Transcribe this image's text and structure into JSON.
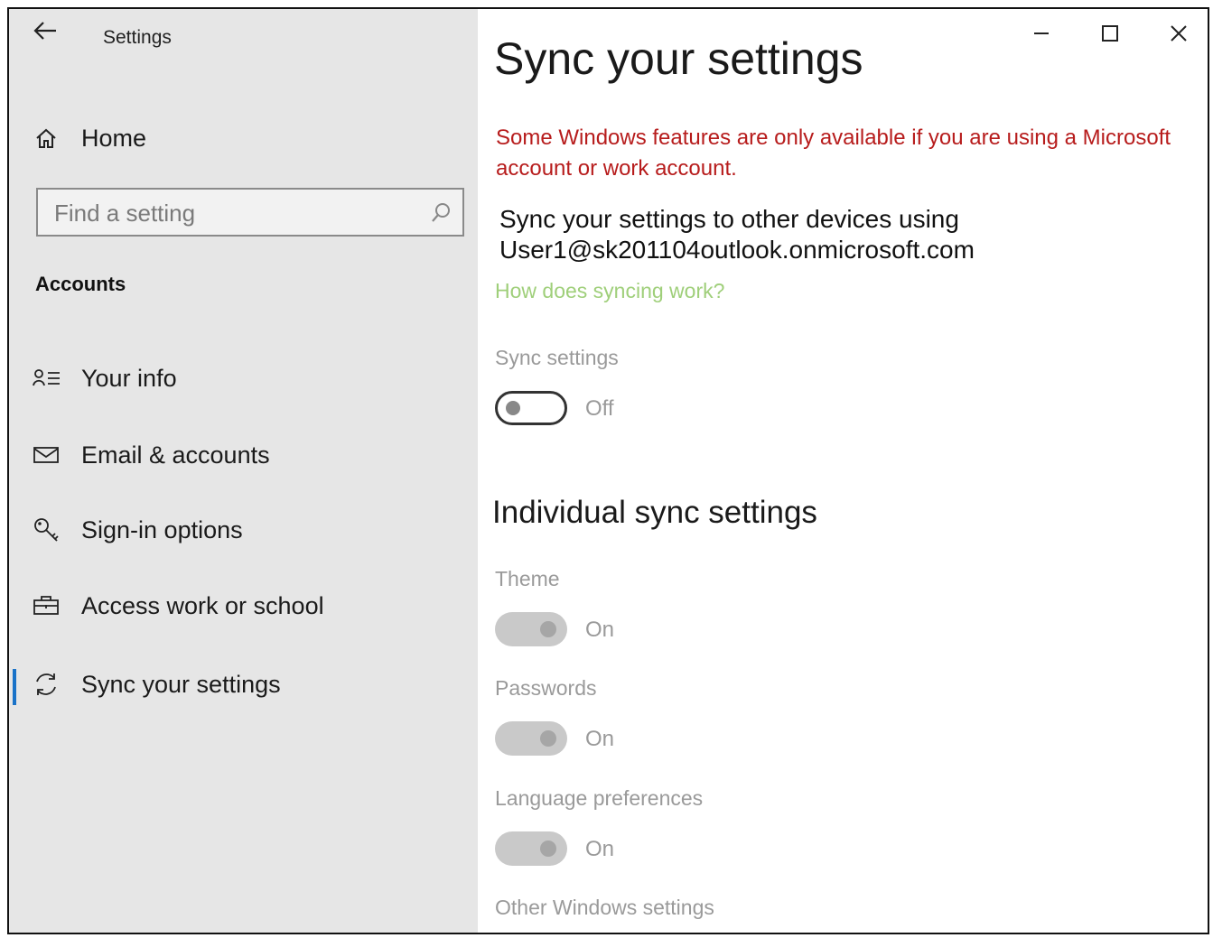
{
  "app": {
    "title": "Settings"
  },
  "sidebar": {
    "home_label": "Home",
    "search": {
      "placeholder": "Find a setting"
    },
    "section_title": "Accounts",
    "items": [
      {
        "label": "Your info",
        "icon": "person-list-icon"
      },
      {
        "label": "Email & accounts",
        "icon": "envelope-icon"
      },
      {
        "label": "Sign-in options",
        "icon": "key-icon"
      },
      {
        "label": "Access work or school",
        "icon": "briefcase-icon"
      },
      {
        "label": "Sync your settings",
        "icon": "sync-icon",
        "selected": true
      }
    ]
  },
  "main": {
    "title": "Sync your settings",
    "warning": "Some Windows features are only available if you are using a Microsoft account or work account.",
    "sync_desc_line1": "Sync your settings to other devices using",
    "sync_desc_line2": "User1@sk201104outlook.onmicrosoft.com",
    "help_link": "How does syncing work?",
    "sync_settings": {
      "label": "Sync settings",
      "state": "Off"
    },
    "individual_heading": "Individual sync settings",
    "individual": [
      {
        "label": "Theme",
        "state": "On"
      },
      {
        "label": "Passwords",
        "state": "On"
      },
      {
        "label": "Language preferences",
        "state": "On"
      }
    ],
    "other_label": "Other Windows settings"
  },
  "colors": {
    "sidebar_bg": "#e6e6e6",
    "warning": "#b71c1c",
    "link": "#9fcf7a",
    "accent": "#1a73c8"
  }
}
